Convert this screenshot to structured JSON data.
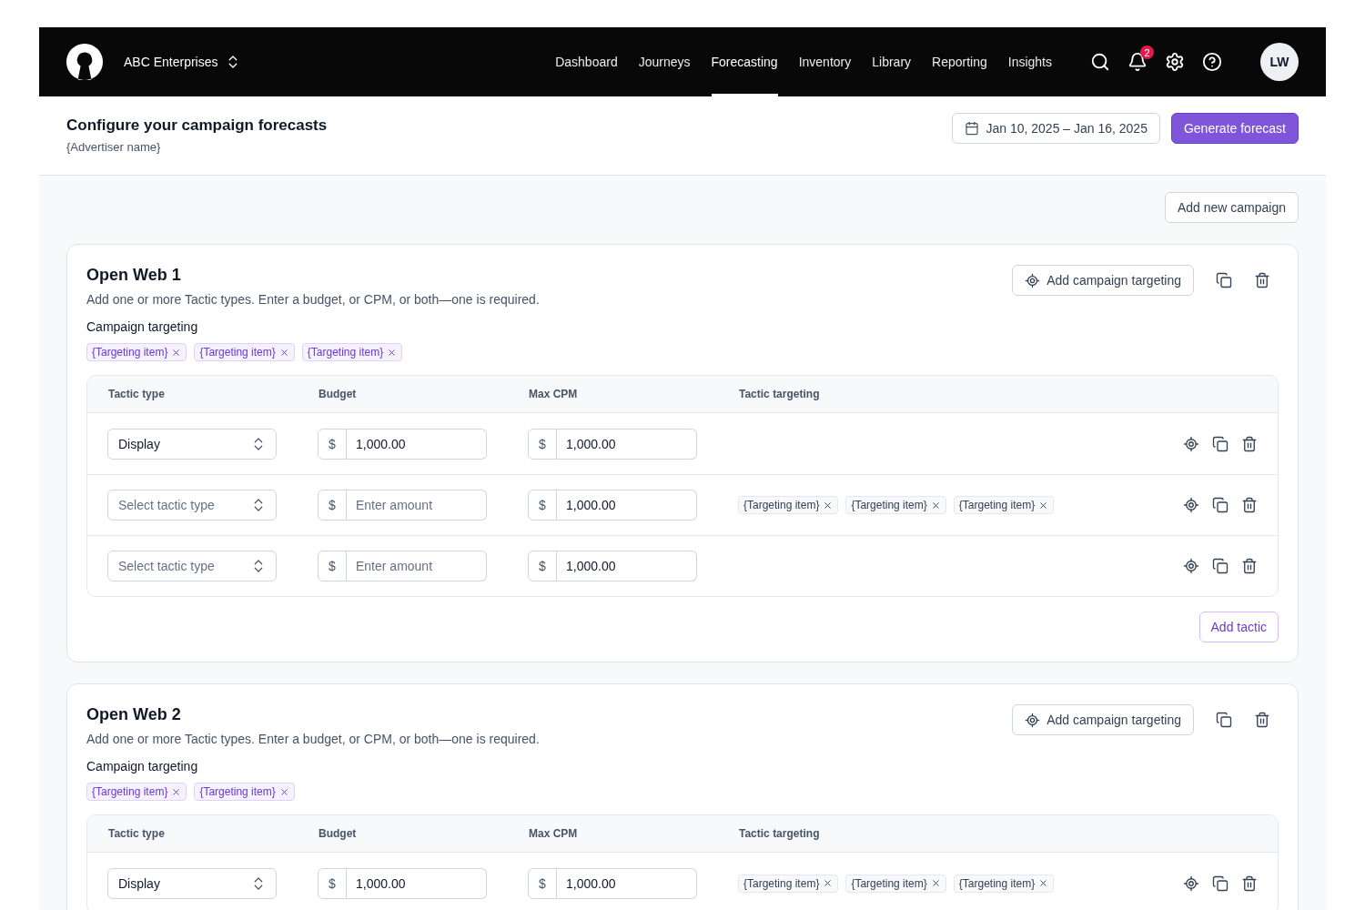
{
  "nav": {
    "brand": "ABC Enterprises",
    "links": [
      {
        "label": "Dashboard",
        "selected": false
      },
      {
        "label": "Journeys",
        "selected": false
      },
      {
        "label": "Forecasting",
        "selected": true
      },
      {
        "label": "Inventory",
        "selected": false
      },
      {
        "label": "Library",
        "selected": false
      },
      {
        "label": "Reporting",
        "selected": false
      },
      {
        "label": "Insights",
        "selected": false
      }
    ],
    "notification_count": "2",
    "avatar": "LW"
  },
  "header": {
    "title": "Configure your campaign forecasts",
    "subtitle": "{Advertiser name}",
    "date_range": "Jan 10, 2025 – Jan 16, 2025",
    "generate_button": "Generate forecast"
  },
  "add_campaign_button": "Add new campaign",
  "campaigns": [
    {
      "title": "Open Web 1",
      "description": "Add one or more Tactic types. Enter a budget, or CPM, or both—one is required.",
      "add_targeting_button": "Add campaign targeting",
      "targeting_label": "Campaign targeting",
      "targeting": [
        "{Targeting item}",
        "{Targeting item}",
        "{Targeting item}"
      ],
      "columns": [
        "Tactic type",
        "Budget",
        "Max CPM",
        "Tactic targeting"
      ],
      "tactics": [
        {
          "tactic_type": {
            "value": "Display"
          },
          "budget": {
            "currency": "$",
            "value": "1,000.00"
          },
          "max_cpm": {
            "currency": "$",
            "value": "1,000.00"
          }
        },
        {
          "tactic_type": {
            "placeholder": "Select tactic type"
          },
          "budget": {
            "currency": "$",
            "placeholder": "Enter amount"
          },
          "max_cpm": {
            "currency": "$",
            "value": "1,000.00"
          },
          "targeting": [
            "{Targeting item}",
            "{Targeting item}",
            "{Targeting item}"
          ]
        },
        {
          "tactic_type": {
            "placeholder": "Select tactic type"
          },
          "budget": {
            "currency": "$",
            "placeholder": "Enter amount"
          },
          "max_cpm": {
            "currency": "$",
            "value": "1,000.00"
          }
        }
      ],
      "add_tactic_button": "Add tactic"
    },
    {
      "title": "Open Web 2",
      "description": "Add one or more Tactic types. Enter a budget, or CPM, or both—one is required.",
      "add_targeting_button": "Add campaign targeting",
      "targeting_label": "Campaign targeting",
      "targeting": [
        "{Targeting item}",
        "{Targeting item}"
      ],
      "columns": [
        "Tactic type",
        "Budget",
        "Max CPM",
        "Tactic targeting"
      ],
      "tactics": [
        {
          "tactic_type": {
            "value": "Display"
          },
          "budget": {
            "currency": "$",
            "value": "1,000.00"
          },
          "max_cpm": {
            "currency": "$",
            "value": "1,000.00"
          },
          "targeting": [
            "{Targeting item}",
            "{Targeting item}",
            "{Targeting item}"
          ]
        }
      ]
    }
  ]
}
